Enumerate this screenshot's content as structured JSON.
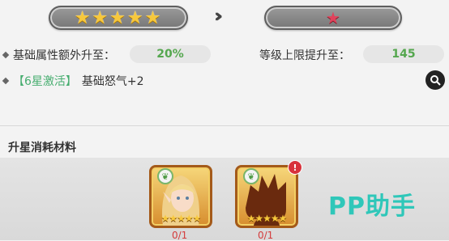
{
  "upgrade": {
    "current_stars": 5,
    "current_star_glyphs": "★★★★★",
    "next_star_glyph": "★",
    "arrow": "›››"
  },
  "stats": {
    "attr_label": "基础属性额外升至：",
    "attr_value": "20%",
    "level_label": "等级上限提升至：",
    "level_value": "145",
    "activation_tag": "【6星激活】",
    "activation_text": "基础怒气+2"
  },
  "materials": {
    "title": "升星消耗材料",
    "items": [
      {
        "name": "elf-hero-card",
        "stars": "★★★★★",
        "count": "0/1",
        "has_alert": false
      },
      {
        "name": "unknown-hero-card",
        "stars": "★★★★★",
        "count": "0/1",
        "has_alert": true,
        "alert": "!"
      }
    ]
  },
  "watermark": "PP助手",
  "colors": {
    "accent_green": "#46ad6f",
    "star_gold": "#f7c83c",
    "star_red": "#e0425b",
    "alert_red": "#d8323c"
  }
}
